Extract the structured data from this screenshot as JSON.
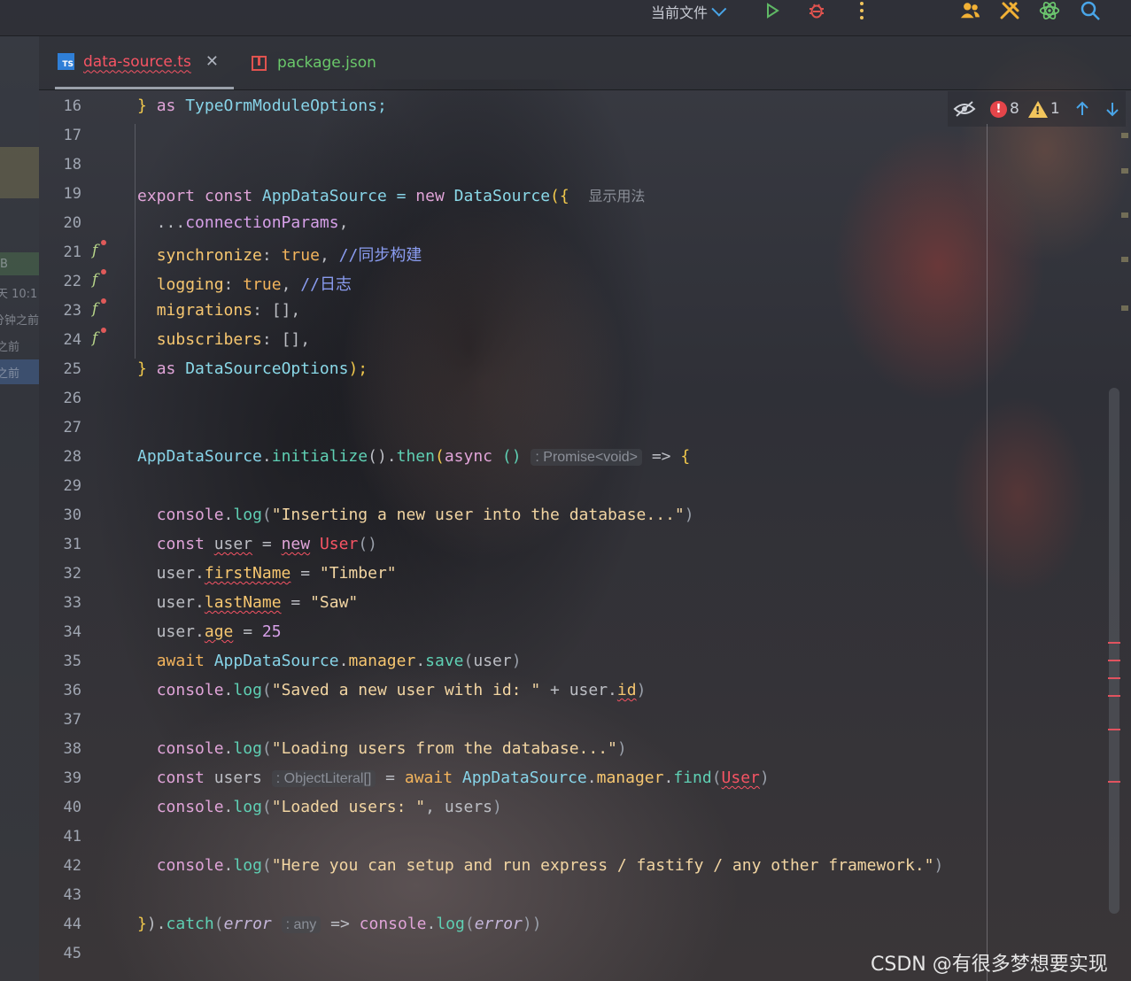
{
  "toolbar": {
    "run_config_label": "当前文件",
    "icons": [
      "run-icon",
      "debug-icon",
      "more-options-icon",
      "code-with-me-icon",
      "build-tools-icon",
      "ai-assistant-icon",
      "search-icon"
    ]
  },
  "left_strip": {
    "fragments": [
      "B",
      "天 10:1",
      "分钟之前",
      "之前",
      "之前"
    ]
  },
  "tabs": [
    {
      "label": "data-source.ts",
      "icon": "typescript-file-icon",
      "active": true,
      "has_errors": true
    },
    {
      "label": "package.json",
      "icon": "json-file-icon",
      "active": false
    }
  ],
  "inspections": {
    "errors": "8",
    "warnings": "1",
    "icons": [
      "hide-inlay-hints-icon",
      "error-icon",
      "warning-icon",
      "previous-highlight-icon",
      "next-highlight-icon"
    ]
  },
  "editor": {
    "language": "TypeScript",
    "line_numbers": [
      "16",
      "17",
      "18",
      "19",
      "20",
      "21",
      "22",
      "23",
      "24",
      "25",
      "26",
      "27",
      "28",
      "29",
      "30",
      "31",
      "32",
      "33",
      "34",
      "35",
      "36",
      "37",
      "38",
      "39",
      "40",
      "41",
      "42",
      "43",
      "44",
      "45"
    ],
    "lines": {
      "l16": {
        "a": "} ",
        "b": "as",
        "c": " TypeOrmModuleOptions;"
      },
      "l19": {
        "a": "export",
        "b": " ",
        "c": "const",
        "d": " AppDataSource = ",
        "e": "new",
        "f": " ",
        "g": "DataSource",
        "h": "(",
        "i": "{",
        "hint": "显示用法"
      },
      "l20": {
        "a": "  ...",
        "b": "connectionParams",
        "c": ","
      },
      "l21": {
        "a": "  ",
        "b": "synchronize",
        "c": ": ",
        "d": "true",
        "e": ", ",
        "f": "//同步构建"
      },
      "l22": {
        "a": "  ",
        "b": "logging",
        "c": ": ",
        "d": "true",
        "e": ", ",
        "f": "//日志"
      },
      "l23": {
        "a": "  ",
        "b": "migrations",
        "c": ": [],"
      },
      "l24": {
        "a": "  ",
        "b": "subscribers",
        "c": ": [],"
      },
      "l25": {
        "a": "}",
        "b": " ",
        "c": "as",
        "d": " ",
        "e": "DataSourceOptions",
        "f": ");"
      },
      "l28": {
        "a": "AppDataSource",
        "b": ".",
        "c": "initialize",
        "d": "().",
        "e": "then",
        "f": "(",
        "g": "async",
        "h": " ()",
        "hint": ": Promise<void>",
        "i": " => ",
        "j": "{"
      },
      "l30": {
        "a": "  ",
        "b": "console",
        "c": ".",
        "d": "log",
        "e": "(",
        "f": "\"Inserting a new user into the database...\"",
        "g": ")"
      },
      "l31": {
        "a": "  ",
        "b": "const",
        "c": " ",
        "d": "user",
        "e": " = ",
        "f": "new",
        "g": " ",
        "h": "User",
        "i": "()"
      },
      "l32": {
        "a": "  user.",
        "b": "firstName",
        "c": " = ",
        "d": "\"Timber\""
      },
      "l33": {
        "a": "  user.",
        "b": "lastName",
        "c": " = ",
        "d": "\"Saw\""
      },
      "l34": {
        "a": "  user.",
        "b": "age",
        "c": " = ",
        "d": "25"
      },
      "l35": {
        "a": "  ",
        "b": "await",
        "c": " ",
        "d": "AppDataSource",
        "e": ".",
        "f": "manager",
        "g": ".",
        "h": "save",
        "i": "(",
        "j": "user",
        "k": ")"
      },
      "l36": {
        "a": "  ",
        "b": "console",
        "c": ".",
        "d": "log",
        "e": "(",
        "f": "\"Saved a new user with id: \"",
        "g": " + user.",
        "h": "id",
        "i": ")"
      },
      "l38": {
        "a": "  ",
        "b": "console",
        "c": ".",
        "d": "log",
        "e": "(",
        "f": "\"Loading users from the database...\"",
        "g": ")"
      },
      "l39": {
        "a": "  ",
        "b": "const",
        "c": " users ",
        "hint": ": ObjectLiteral[]",
        "d": " = ",
        "e": "await",
        "f": " ",
        "g": "AppDataSource",
        "h": ".",
        "i": "manager",
        "j": ".",
        "k": "find",
        "l": "(",
        "m": "User",
        "n": ")"
      },
      "l40": {
        "a": "  ",
        "b": "console",
        "c": ".",
        "d": "log",
        "e": "(",
        "f": "\"Loaded users: \"",
        "g": ", users",
        "h": ")"
      },
      "l42": {
        "a": "  ",
        "b": "console",
        "c": ".",
        "d": "log",
        "e": "(",
        "f": "\"Here you can setup and run express / fastify / any other framework.\"",
        "g": ")"
      },
      "l44": {
        "a": "}",
        "b": ").",
        "c": "catch",
        "d": "(",
        "e": "error",
        "hint": ": any",
        "f": " => ",
        "g": "console",
        "h": ".",
        "i": "log",
        "j": "(",
        "k": "error",
        "l": "))"
      }
    }
  },
  "watermark": "CSDN @有很多梦想要实现",
  "colors": {
    "error": "#f75464",
    "warning": "#f2c55c",
    "keyword": "#e0a4d8",
    "string": "#f2d5a2",
    "comment": "#8a9cf0"
  }
}
